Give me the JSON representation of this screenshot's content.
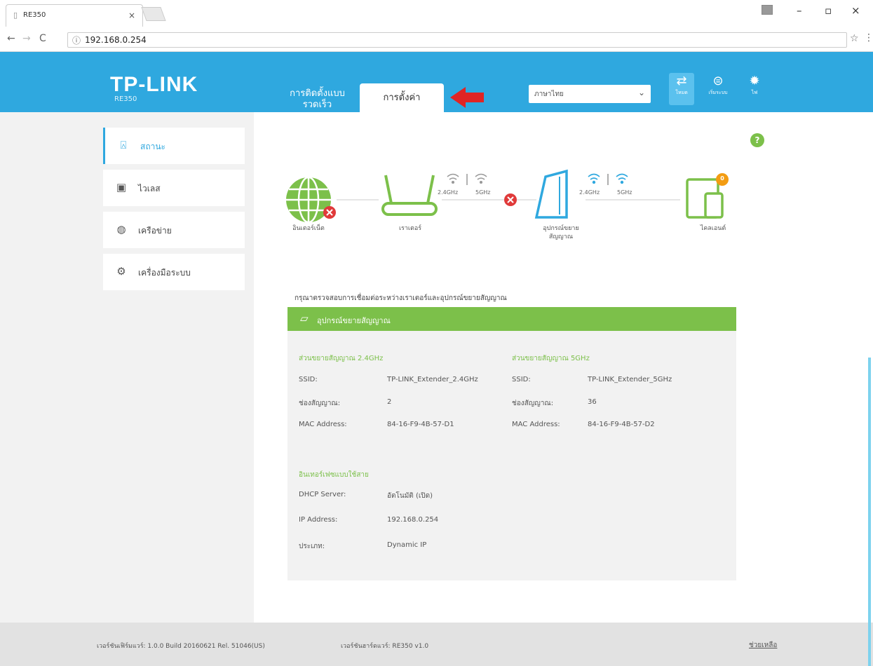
{
  "browser": {
    "tab_title": "RE350",
    "close_glyph": "×",
    "url": "192.168.0.254",
    "window_min": "–",
    "window_max": "▫",
    "window_close": "×"
  },
  "header": {
    "brand": "TP-LINK",
    "model": "RE350",
    "quick_setup": "การติดตั้งแบบรวดเร็ว",
    "settings_tab": "การตั้งค่า",
    "language_value": "ภาษาไทย",
    "buttons": [
      {
        "icon": "mode-icon",
        "label": "โหมด"
      },
      {
        "icon": "reboot-icon",
        "label": "เริ่มระบบ"
      },
      {
        "icon": "led-icon",
        "label": "ไฟ"
      }
    ],
    "accent": "#2fa8df"
  },
  "sidebar": {
    "items": [
      {
        "icon": "status-icon",
        "label": "สถานะ",
        "active": true
      },
      {
        "icon": "wireless-icon",
        "label": "ไวเลส"
      },
      {
        "icon": "network-icon",
        "label": "เครือข่าย"
      },
      {
        "icon": "system-tools-icon",
        "label": "เครื่องมือระบบ"
      }
    ]
  },
  "topology": {
    "internet": "อินเตอร์เน็ต",
    "router": "เราเตอร์",
    "extender": "อุปกรณ์ขยายสัญญาณ",
    "clients": "ไคลเอนต์",
    "band_24": "2.4GHz",
    "band_5": "5GHz",
    "client_count": "0"
  },
  "main": {
    "description": "กรุณาตรวจสอบการเชื่อมต่อระหว่างเราเตอร์และอุปกรณ์ขยายสัญญาณ",
    "panel_title": "อุปกรณ์ขยายสัญญาณ",
    "ext24": {
      "section": "ส่วนขยายสัญญาณ 2.4GHz",
      "ssid_label": "SSID:",
      "ssid": "TP-LINK_Extender_2.4GHz",
      "channel_label": "ช่องสัญญาณ:",
      "channel": "2",
      "mac_label": "MAC Address:",
      "mac": "84-16-F9-4B-57-D1"
    },
    "ext5": {
      "section": "ส่วนขยายสัญญาณ 5GHz",
      "ssid_label": "SSID:",
      "ssid": "TP-LINK_Extender_5GHz",
      "channel_label": "ช่องสัญญาณ:",
      "channel": "36",
      "mac_label": "MAC Address:",
      "mac": "84-16-F9-4B-57-D2"
    },
    "lan": {
      "section": "อินเทอร์เฟซแบบใช้สาย",
      "dhcp_label": "DHCP Server:",
      "dhcp": "อัตโนมัติ (เปิด)",
      "ip_label": "IP Address:",
      "ip": "192.168.0.254",
      "type_label": "ประเภท:",
      "type": "Dynamic IP"
    }
  },
  "footer": {
    "firmware": "เวอร์ชันเฟิร์มแวร์: 1.0.0 Build 20160621 Rel. 51046(US)",
    "hardware": "เวอร์ชันฮาร์ดแวร์: RE350 v1.0",
    "support": "ช่วยเหลือ"
  },
  "colors": {
    "green": "#7cc04a",
    "blue": "#2fa8df",
    "red": "#e03a3a",
    "orange": "#f39c12"
  }
}
